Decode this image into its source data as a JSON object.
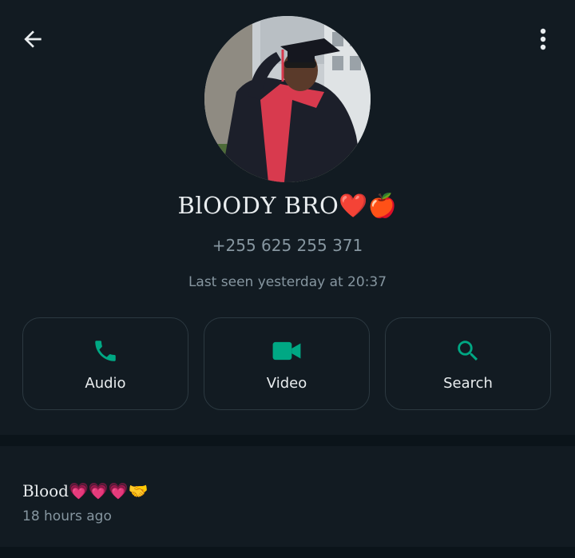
{
  "header": {
    "back_icon": "arrow-left-icon",
    "menu_icon": "more-vertical-icon"
  },
  "profile": {
    "name": "BlOODY BRO❤️🍎",
    "phone": "+255 625 255 371",
    "last_seen": "Last seen yesterday at 20:37"
  },
  "actions": [
    {
      "label": "Audio",
      "icon": "phone-icon"
    },
    {
      "label": "Video",
      "icon": "video-camera-icon"
    },
    {
      "label": "Search",
      "icon": "search-icon"
    }
  ],
  "about": {
    "text": "Blood💗💗💗🤝",
    "time": "18 hours ago"
  },
  "colors": {
    "background": "#121b22",
    "accent": "#00a884",
    "primary_text": "#e9edef",
    "secondary_text": "#8696a0",
    "card_border": "#2c3941"
  }
}
